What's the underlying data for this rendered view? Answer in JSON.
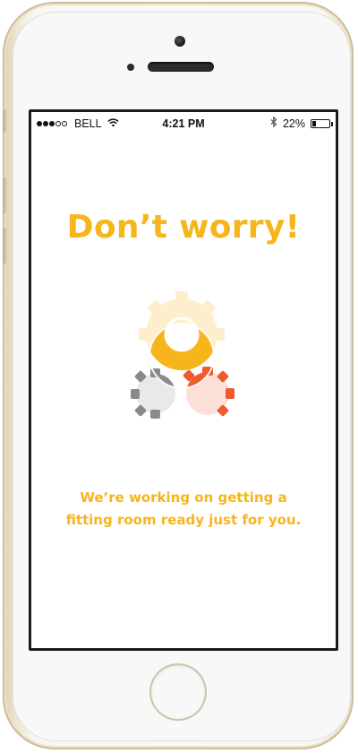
{
  "status_bar": {
    "signal_bars_filled": 3,
    "signal_bars_total": 5,
    "carrier": "BELL",
    "time": "4:21 PM",
    "battery_percent": "22%",
    "battery_level": 0.22,
    "icons": [
      "signal-dots-icon",
      "wifi-icon",
      "bluetooth-icon",
      "battery-icon"
    ]
  },
  "screen": {
    "headline": "Don’t worry!",
    "message_line1": "We’re working on getting a",
    "message_line2": "fitting room ready just for you.",
    "illustration": "gears-loading-icon"
  },
  "colors": {
    "accent": "#f7b51c",
    "gear_gray": "#8a8a8a",
    "gear_red": "#ef5a2f",
    "phone_bezel": "#f8f8f9",
    "phone_trim": "#e6dac0"
  }
}
